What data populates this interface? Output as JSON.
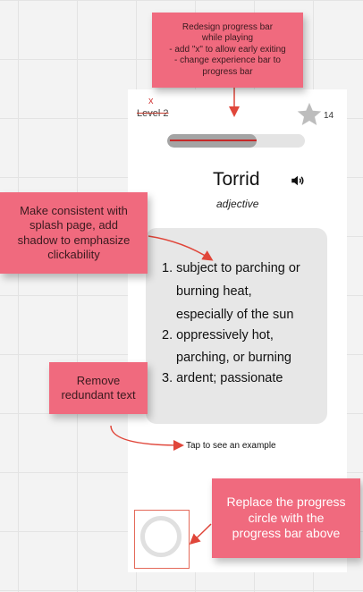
{
  "screen": {
    "level_label": "Level 2",
    "close_mark": "x",
    "star_count": "14",
    "progress_fraction": 0.65,
    "word": "Torrid",
    "part_of_speech": "adjective",
    "definitions": [
      "1. subject to parching or",
      "burning heat,",
      "especially of the sun",
      "2. oppressively hot,",
      "parching, or burning",
      "3. ardent; passionate"
    ],
    "tap_hint": "Tap to see an example"
  },
  "notes": {
    "progress_note": [
      "Redesign progress bar",
      "while playing",
      "- add \"x\" to allow early exiting",
      "- change experience bar to",
      "progress bar"
    ],
    "card_note": [
      "Make consistent with",
      "splash page, add",
      "shadow to emphasize",
      "clickability"
    ],
    "text_note": [
      "Remove",
      "redundant text"
    ],
    "circle_note": [
      "Replace the progress",
      "circle with the",
      "progress bar above"
    ]
  },
  "colors": {
    "sticky": "#f06a7e",
    "annotation_red": "#e0463a"
  },
  "icons": {
    "star": "star-icon",
    "speaker": "speaker-icon"
  }
}
